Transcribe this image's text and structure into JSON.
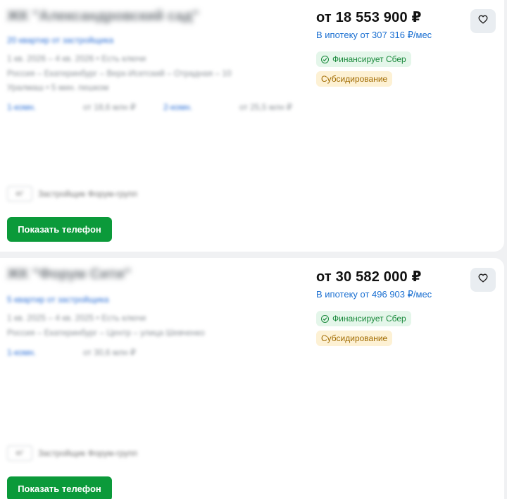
{
  "listings": [
    {
      "title": "ЖК \"Александровский сад\"",
      "subtitle": "20 квартир от застройщика",
      "line1": "1 кв. 2026 – 4 кв. 2026 • Есть ключи",
      "line2": "Россия – Екатеринбург – Верх-Исетский – Отрадная – 10",
      "line3": "Уралмаш • 5 мин. пешком",
      "rooms": [
        {
          "label": "1-комн.",
          "price": "от 18,6 млн ₽"
        },
        {
          "label": "2-комн.",
          "price": "от 25,5 млн ₽"
        }
      ],
      "developer": "Застройщик Форум-групп",
      "developer_logo": "ФГ",
      "price": "от 18 553 900 ₽",
      "mortgage": "В ипотеку от 307 316 ₽/мес",
      "badge_financing": "Финансирует Сбер",
      "badge_subsidy": "Субсидирование",
      "phone_button": "Показать телефон"
    },
    {
      "title": "ЖК \"Форум Сити\"",
      "subtitle": "5 квартир от застройщика",
      "line1": "1 кв. 2025 – 4 кв. 2025 • Есть ключи",
      "line2": "Россия – Екатеринбург – Центр – улица Шевченко",
      "line3": "",
      "rooms": [
        {
          "label": "1-комн.",
          "price": "от 30,6 млн ₽"
        }
      ],
      "developer": "Застройщик Форум-групп",
      "developer_logo": "ФГ",
      "price": "от 30 582 000 ₽",
      "mortgage": "В ипотеку от 496 903 ₽/мес",
      "badge_financing": "Финансирует Сбер",
      "badge_subsidy": "Субсидирование",
      "phone_button": "Показать телефон"
    }
  ],
  "icons": {
    "favorite": "heart-outline-icon",
    "financing": "check-circle-icon"
  },
  "colors": {
    "accent_green": "#0b9a3a",
    "link_blue": "#1a6fd1",
    "badge_green_bg": "#e4f6ea",
    "badge_yellow_bg": "#fdf1d4"
  }
}
